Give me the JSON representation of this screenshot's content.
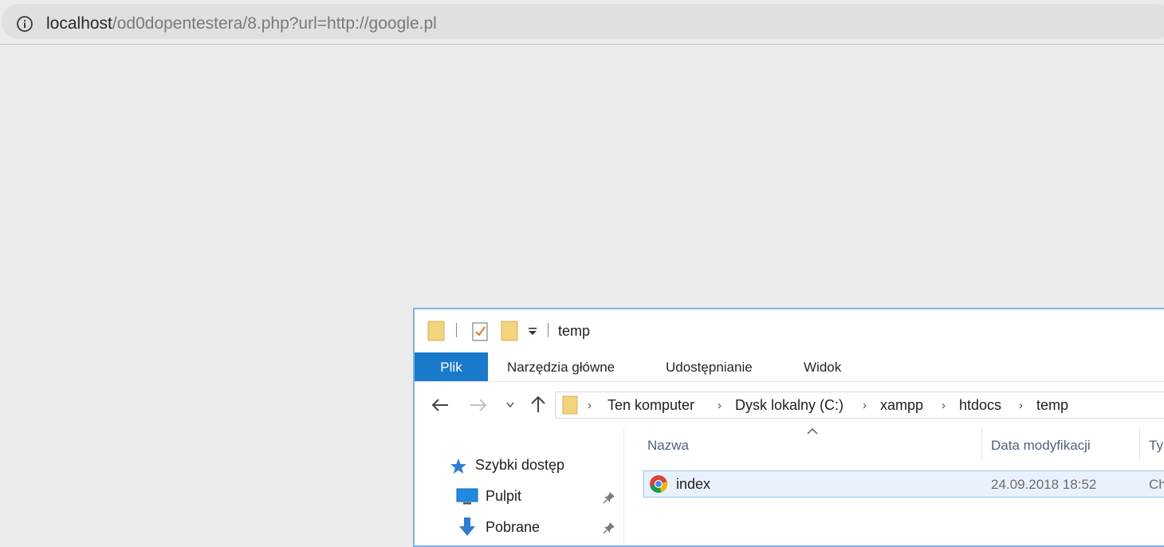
{
  "browser": {
    "url_host": "localhost",
    "url_path": "/od0dopentestera/8.php?url=http://google.pl"
  },
  "explorer": {
    "title": "temp",
    "ribbon_tabs": [
      "Plik",
      "Narzędzia główne",
      "Udostępnianie",
      "Widok"
    ],
    "breadcrumb": [
      "Ten komputer",
      "Dysk lokalny (C:)",
      "xampp",
      "htdocs",
      "temp"
    ],
    "nav_items": [
      "Szybki dostęp",
      "Pulpit",
      "Pobrane"
    ],
    "columns": [
      "Nazwa",
      "Data modyfikacji",
      "Ty"
    ],
    "files": [
      {
        "name": "index",
        "date": "24.09.2018 18:52",
        "type": "Ch"
      }
    ]
  }
}
